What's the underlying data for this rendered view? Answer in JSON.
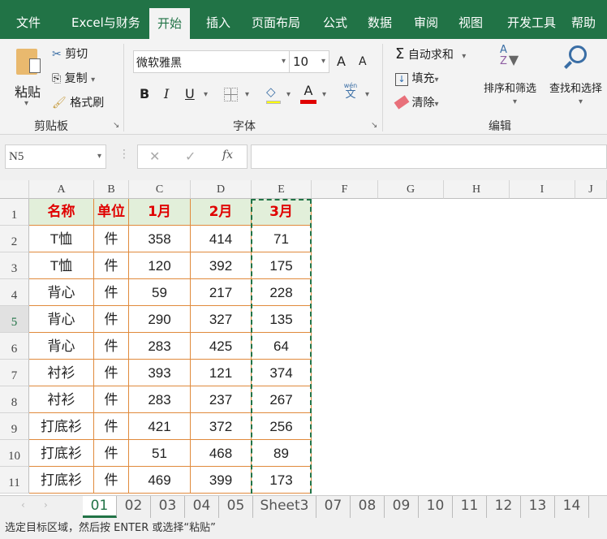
{
  "menu_tabs": [
    "文件",
    "Excel与财务",
    "开始",
    "插入",
    "页面布局",
    "公式",
    "数据",
    "审阅",
    "视图",
    "开发工具",
    "帮助"
  ],
  "active_tab": "开始",
  "ribbon": {
    "clipboard": {
      "paste": "粘贴",
      "cut": "剪切",
      "copy": "复制",
      "format_painter": "格式刷",
      "group": "剪贴板"
    },
    "font": {
      "font_name": "微软雅黑",
      "font_size": "10",
      "bold": "B",
      "italic": "I",
      "underline": "U",
      "group": "字体",
      "phonetic": "wén",
      "phonetic2": "文",
      "grow": "A",
      "shrink": "A",
      "font_color": "A"
    },
    "editing": {
      "autosum": "自动求和",
      "fill": "填充",
      "clear": "清除",
      "sort_filter": "排序和筛选",
      "find_select": "查找和选择",
      "group": "编辑"
    },
    "accent_red": "#e00000"
  },
  "formula_bar": {
    "name_box": "N5",
    "fx": "fx",
    "cancel": "✕",
    "enter": "✓",
    "formula": ""
  },
  "columns": [
    "A",
    "B",
    "C",
    "D",
    "E",
    "F",
    "G",
    "H",
    "I",
    "J"
  ],
  "rows": [
    "1",
    "2",
    "3",
    "4",
    "5",
    "6",
    "7",
    "8",
    "9",
    "10",
    "11"
  ],
  "table": {
    "headers": [
      "名称",
      "单位",
      "1月",
      "2月",
      "3月"
    ],
    "data": [
      [
        "T恤",
        "件",
        "358",
        "414",
        "71"
      ],
      [
        "T恤",
        "件",
        "120",
        "392",
        "175"
      ],
      [
        "背心",
        "件",
        "59",
        "217",
        "228"
      ],
      [
        "背心",
        "件",
        "290",
        "327",
        "135"
      ],
      [
        "背心",
        "件",
        "283",
        "425",
        "64"
      ],
      [
        "衬衫",
        "件",
        "393",
        "121",
        "374"
      ],
      [
        "衬衫",
        "件",
        "283",
        "237",
        "267"
      ],
      [
        "打底衫",
        "件",
        "421",
        "372",
        "256"
      ],
      [
        "打底衫",
        "件",
        "51",
        "468",
        "89"
      ],
      [
        "打底衫",
        "件",
        "469",
        "399",
        "173"
      ]
    ]
  },
  "sheet_tabs": [
    "01",
    "02",
    "03",
    "04",
    "05",
    "Sheet3",
    "07",
    "08",
    "09",
    "10",
    "11",
    "12",
    "13",
    "14"
  ],
  "active_sheet": "01",
  "status_text": "选定目标区域，然后按 ENTER 或选择“粘贴”"
}
